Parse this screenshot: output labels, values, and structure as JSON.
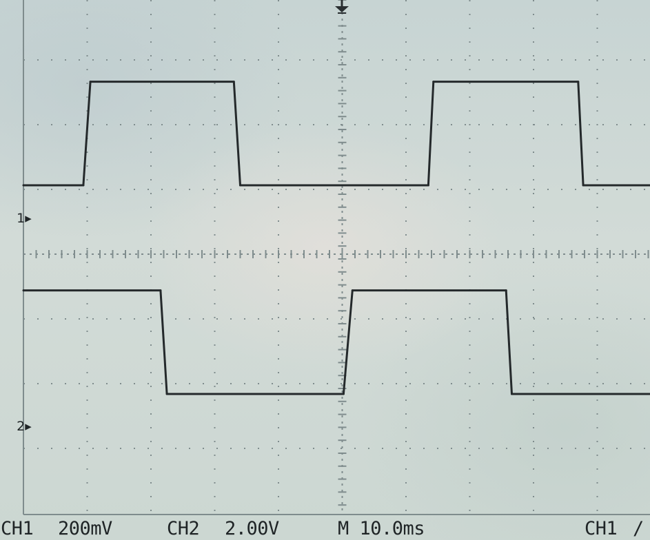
{
  "scope": {
    "ch1_label": "CH1",
    "ch1_scale": "200mV",
    "ch2_label": "CH2",
    "ch2_scale": "2.00V",
    "timebase": "M 10.0ms",
    "trigger_source": "CH1",
    "trigger_slope_glyph": "/",
    "ch1_marker": "1",
    "ch2_marker": "2",
    "colors": {
      "trace": "#24292b",
      "graticule": "#7f8c8d",
      "screen": "#cbd7d4"
    },
    "icons": {
      "trigger_position": "trigger-position-icon",
      "channel_marker": "ground-marker-icon"
    }
  },
  "chart_data": {
    "type": "line",
    "x_unit": "ms",
    "time_per_division_ms": 10,
    "divisions": {
      "horizontal": 10,
      "vertical": 8
    },
    "grid": true,
    "series": [
      {
        "name": "CH1",
        "volts_per_division": 0.2,
        "x": [
          -50,
          -40.6,
          -39.5,
          -17.0,
          -16.0,
          13.5,
          14.3,
          37.0,
          37.8,
          50
        ],
        "y": [
          0,
          0,
          0.32,
          0.32,
          0,
          0,
          0.32,
          0.32,
          0,
          0
        ]
      },
      {
        "name": "CH2",
        "volts_per_division": 2.0,
        "x": [
          -50,
          -28.5,
          -27.5,
          0.2,
          1.6,
          25.7,
          26.6,
          50
        ],
        "y": [
          3.2,
          3.2,
          0,
          0,
          3.2,
          3.2,
          0,
          0
        ]
      }
    ]
  }
}
